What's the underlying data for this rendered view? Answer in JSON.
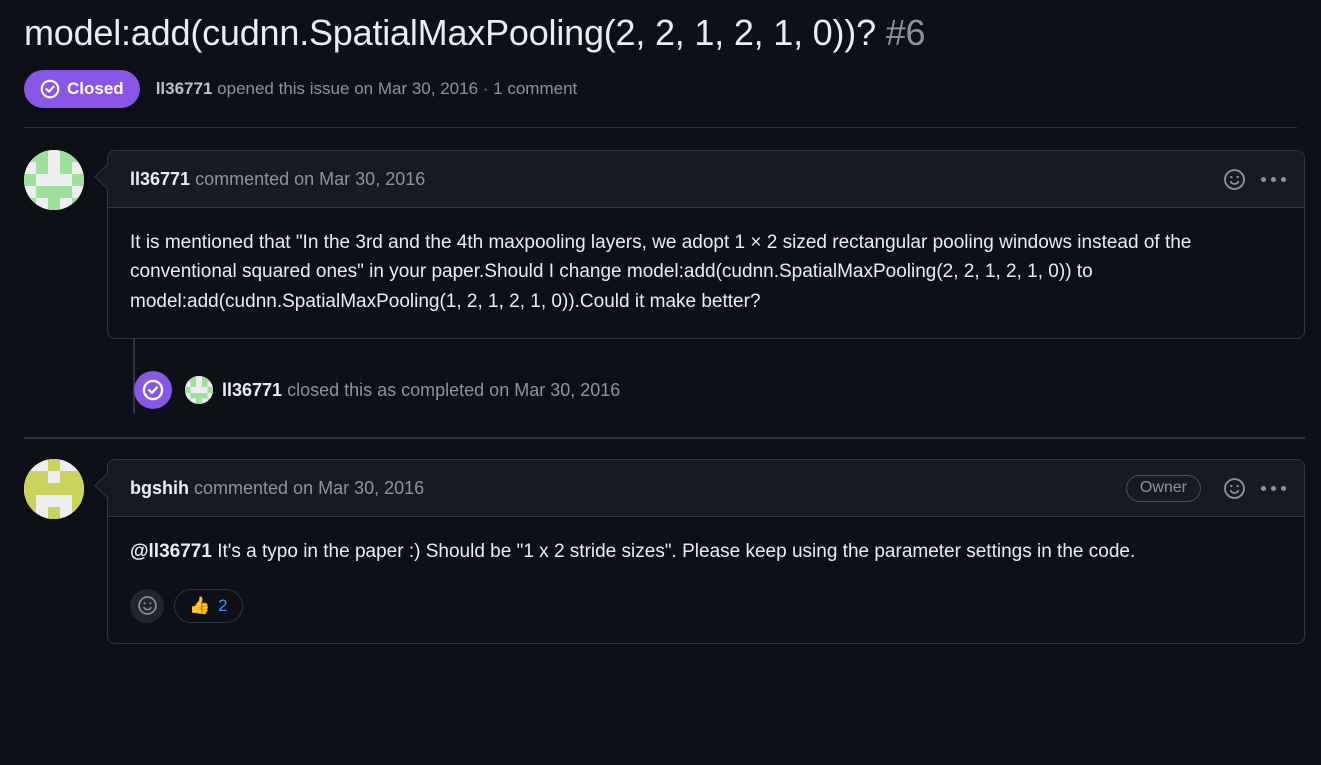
{
  "issue": {
    "title": "model:add(cudnn.SpatialMaxPooling(2, 2, 1, 2, 1, 0))?",
    "number": "#6",
    "state_label": "Closed",
    "state_color": "#8957e5",
    "author": "ll36771",
    "meta_opened": "opened this issue on",
    "meta_date": "Mar 30, 2016",
    "meta_separator": "·",
    "meta_comments": "1 comment"
  },
  "comments": [
    {
      "author": "ll36771",
      "action": "commented on",
      "date": "Mar 30, 2016",
      "badge": null,
      "avatar_color": "#9be09b",
      "body_parts": [
        {
          "type": "text",
          "text": "It is mentioned that \"In the 3rd and the 4th maxpooling layers, we adopt 1 × 2 sized rectangular pooling windows instead of the conventional squared ones\" in your paper.Should I change model:add(cudnn.SpatialMaxPooling(2, 2, 1, 2, 1, 0)) to model:add(cudnn.SpatialMaxPooling(1, 2, 1, 2, 1, 0)).Could it make better?"
        }
      ],
      "reactions": [],
      "reaction_add_icon": "smiley-plus-icon",
      "reaction_icon": "smiley-icon",
      "menu_icon": "kebab-horizontal-icon"
    },
    {
      "author": "bgshih",
      "action": "commented on",
      "date": "Mar 30, 2016",
      "badge": "Owner",
      "avatar_color": "#ccd35a",
      "body_parts": [
        {
          "type": "mention",
          "text": "@ll36771"
        },
        {
          "type": "text",
          "text": " It's a typo in the paper :) Should be \"1 x 2 stride sizes\". Please keep using the parameter settings in the code."
        }
      ],
      "reactions": [
        {
          "emoji": "👍",
          "name": "thumbs-up-reaction",
          "count": "2"
        }
      ],
      "reaction_add_icon": "smiley-plus-icon",
      "reaction_icon": "smiley-icon",
      "menu_icon": "kebab-horizontal-icon"
    }
  ],
  "event": {
    "icon": "issue-closed-icon",
    "icon_color": "#8957e5",
    "author": "ll36771",
    "text": "closed this as completed on",
    "date": "Mar 30, 2016",
    "avatar_color": "#9be09b"
  }
}
